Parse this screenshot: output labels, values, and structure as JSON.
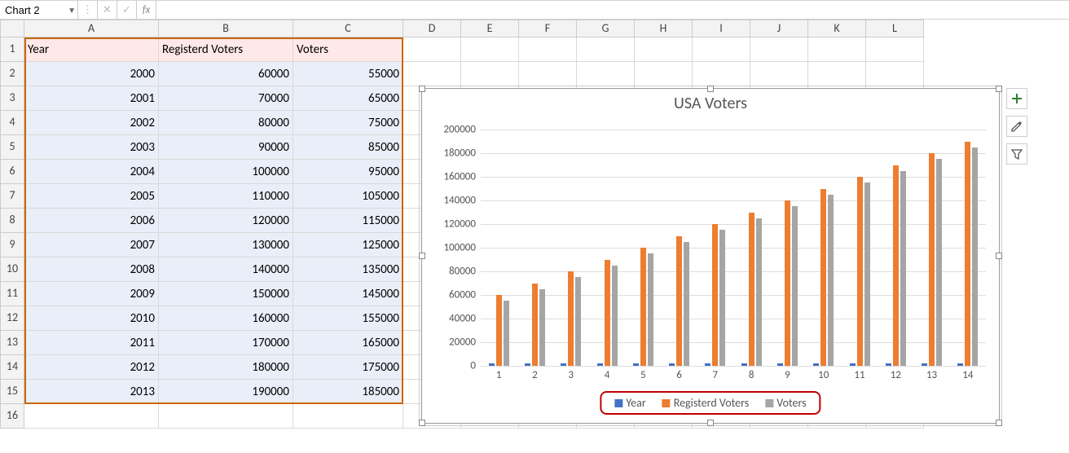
{
  "formula_bar": {
    "name_box": "Chart 2",
    "fx_label": "fx"
  },
  "columns": [
    "A",
    "B",
    "C",
    "D",
    "E",
    "F",
    "G",
    "H",
    "I",
    "J",
    "K",
    "L"
  ],
  "row_count": 16,
  "col_widths": {
    "A": 165,
    "B": 165,
    "C": 135,
    "default": 71
  },
  "table": {
    "headers": [
      "Year",
      "Registerd Voters",
      "Voters"
    ],
    "rows": [
      [
        "2000",
        "60000",
        "55000"
      ],
      [
        "2001",
        "70000",
        "65000"
      ],
      [
        "2002",
        "80000",
        "75000"
      ],
      [
        "2003",
        "90000",
        "85000"
      ],
      [
        "2004",
        "100000",
        "95000"
      ],
      [
        "2005",
        "110000",
        "105000"
      ],
      [
        "2006",
        "120000",
        "115000"
      ],
      [
        "2007",
        "130000",
        "125000"
      ],
      [
        "2008",
        "140000",
        "135000"
      ],
      [
        "2009",
        "150000",
        "145000"
      ],
      [
        "2010",
        "160000",
        "155000"
      ],
      [
        "2011",
        "170000",
        "165000"
      ],
      [
        "2012",
        "180000",
        "175000"
      ],
      [
        "2013",
        "190000",
        "185000"
      ]
    ]
  },
  "chart_data": {
    "type": "bar",
    "title": "USA Voters",
    "categories": [
      "1",
      "2",
      "3",
      "4",
      "5",
      "6",
      "7",
      "8",
      "9",
      "10",
      "11",
      "12",
      "13",
      "14"
    ],
    "series": [
      {
        "name": "Year",
        "color": "#4472c4",
        "values": [
          2000,
          2001,
          2002,
          2003,
          2004,
          2005,
          2006,
          2007,
          2008,
          2009,
          2010,
          2011,
          2012,
          2013
        ]
      },
      {
        "name": "Registerd Voters",
        "color": "#ed7d31",
        "values": [
          60000,
          70000,
          80000,
          90000,
          100000,
          110000,
          120000,
          130000,
          140000,
          150000,
          160000,
          170000,
          180000,
          190000
        ]
      },
      {
        "name": "Voters",
        "color": "#a5a5a5",
        "values": [
          55000,
          65000,
          75000,
          85000,
          95000,
          105000,
          115000,
          125000,
          135000,
          145000,
          155000,
          165000,
          175000,
          185000
        ]
      }
    ],
    "ylim": [
      0,
      200000
    ],
    "ystep": 20000,
    "xlabel": "",
    "ylabel": ""
  },
  "side_buttons": [
    "plus",
    "brush",
    "filter"
  ]
}
